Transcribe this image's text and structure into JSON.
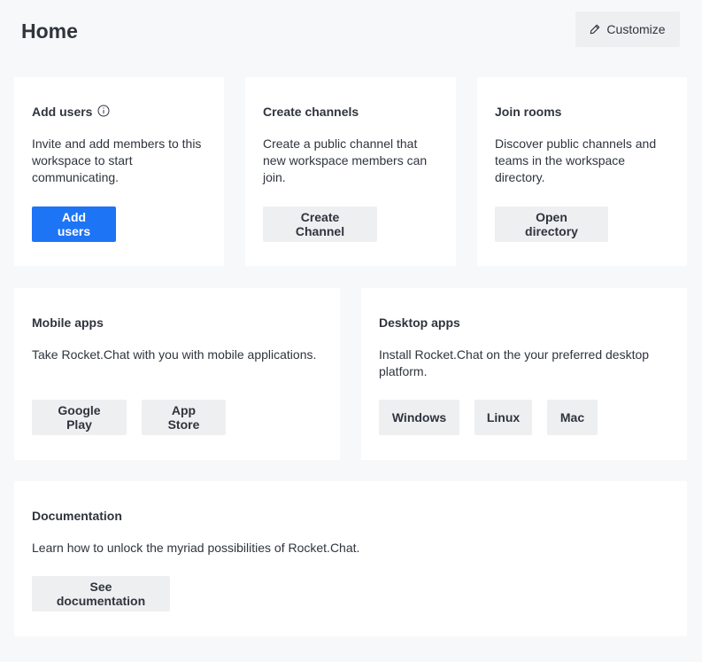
{
  "header": {
    "title": "Home",
    "customize_label": "Customize"
  },
  "cards": {
    "add_users": {
      "title": "Add users",
      "description": "Invite and add members to this workspace to start communicating.",
      "button": "Add users"
    },
    "create_channels": {
      "title": "Create channels",
      "description": "Create a public channel that new workspace members can join.",
      "button": "Create Channel"
    },
    "join_rooms": {
      "title": "Join rooms",
      "description": "Discover public channels and teams in the workspace directory.",
      "button": "Open directory"
    },
    "mobile_apps": {
      "title": "Mobile apps",
      "description": "Take Rocket.Chat with you with mobile applications.",
      "buttons": [
        "Google Play",
        "App Store"
      ]
    },
    "desktop_apps": {
      "title": "Desktop apps",
      "description": "Install Rocket.Chat on the your preferred desktop platform.",
      "buttons": [
        "Windows",
        "Linux",
        "Mac"
      ]
    },
    "documentation": {
      "title": "Documentation",
      "description": "Learn how to unlock the myriad possibilities of Rocket.Chat.",
      "button": "See documentation"
    }
  },
  "icons": {
    "customize": "pencil-icon",
    "add_users_info": "info-icon"
  },
  "colors": {
    "primary": "#1d74f5",
    "background": "#f7f8fa",
    "card": "#ffffff",
    "secondary_button": "#eeeff1"
  }
}
